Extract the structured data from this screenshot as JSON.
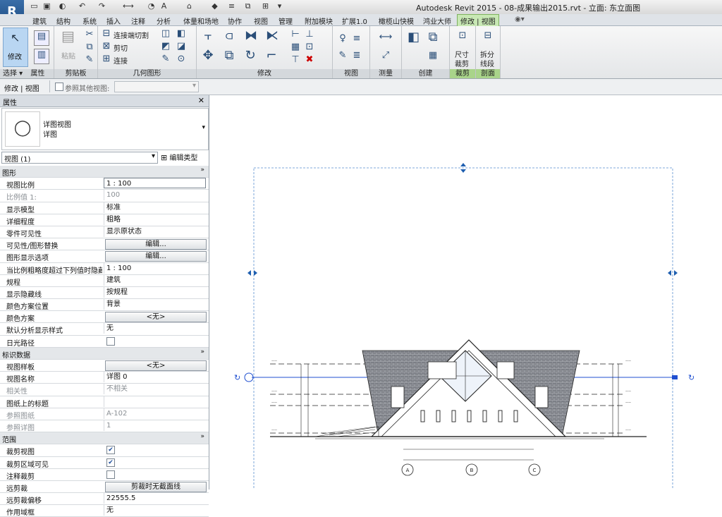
{
  "title": "Autodesk Revit 2015 -    08-成果输出2015.rvt - 立面: 东立面图",
  "app_button": "R",
  "tabs": [
    "建筑",
    "结构",
    "系统",
    "插入",
    "注释",
    "分析",
    "体量和场地",
    "协作",
    "视图",
    "管理",
    "附加模块",
    "扩展1.0",
    "橄榄山快模",
    "鸿业大师",
    "修改 | 视图"
  ],
  "ribbon": {
    "modify": "修改",
    "select": "选择",
    "properties": "属性",
    "paste": "粘贴",
    "clipboard": "剪贴板",
    "join": "连接端切割",
    "cut": "剪切",
    "connect": "连接",
    "geometry": "几何图形",
    "modify_panel": "修改",
    "view_panel": "视图",
    "measure": "测量",
    "create": "创建",
    "crop_size": "尺寸",
    "crop_size2": "裁剪",
    "crop_panel": "裁剪",
    "split": "拆分",
    "split2": "线段",
    "section_panel": "剖面"
  },
  "context": {
    "label": "修改 | 视图",
    "other_view": "参照其他视图:"
  },
  "properties": {
    "header": "属性",
    "type_name": "详图视图",
    "type_sub": "详图",
    "instance": "视图 (1)",
    "edit_type": "编辑类型",
    "rows": [
      {
        "cat": "图形"
      },
      {
        "name": "视图比例",
        "value": "1 : 100",
        "kind": "field"
      },
      {
        "name": "比例值 1:",
        "value": "100",
        "kind": "gray"
      },
      {
        "name": "显示模型",
        "value": "标准"
      },
      {
        "name": "详细程度",
        "value": "粗略"
      },
      {
        "name": "零件可见性",
        "value": "显示原状态"
      },
      {
        "name": "可见性/图形替换",
        "value": "编辑...",
        "kind": "btn"
      },
      {
        "name": "图形显示选项",
        "value": "编辑...",
        "kind": "btn"
      },
      {
        "name": "当比例粗略度超过下列值时隐藏",
        "value": "1 : 100"
      },
      {
        "name": "规程",
        "value": "建筑"
      },
      {
        "name": "显示隐藏线",
        "value": "按规程"
      },
      {
        "name": "颜色方案位置",
        "value": "背景"
      },
      {
        "name": "颜色方案",
        "value": "<无>",
        "kind": "btn"
      },
      {
        "name": "默认分析显示样式",
        "value": "无"
      },
      {
        "name": "日光路径",
        "value": "",
        "kind": "chk"
      },
      {
        "cat": "标识数据"
      },
      {
        "name": "视图样板",
        "value": "<无>",
        "kind": "btn"
      },
      {
        "name": "视图名称",
        "value": "详图 0"
      },
      {
        "name": "相关性",
        "value": "不相关",
        "kind": "gray"
      },
      {
        "name": "图纸上的标题",
        "value": ""
      },
      {
        "name": "参照图纸",
        "value": "A-102",
        "kind": "gray"
      },
      {
        "name": "参照详图",
        "value": "1",
        "kind": "gray"
      },
      {
        "cat": "范围"
      },
      {
        "name": "裁剪视图",
        "value": "✔",
        "kind": "chk"
      },
      {
        "name": "裁剪区域可见",
        "value": "✔",
        "kind": "chk"
      },
      {
        "name": "注释裁剪",
        "value": "",
        "kind": "chk"
      },
      {
        "name": "远剪裁",
        "value": "剪裁时无截面线",
        "kind": "btn"
      },
      {
        "name": "远剪裁偏移",
        "value": "22555.5"
      },
      {
        "name": "作用域框",
        "value": "无"
      }
    ]
  },
  "drawing": {
    "grids": [
      "A",
      "B",
      "C"
    ]
  }
}
